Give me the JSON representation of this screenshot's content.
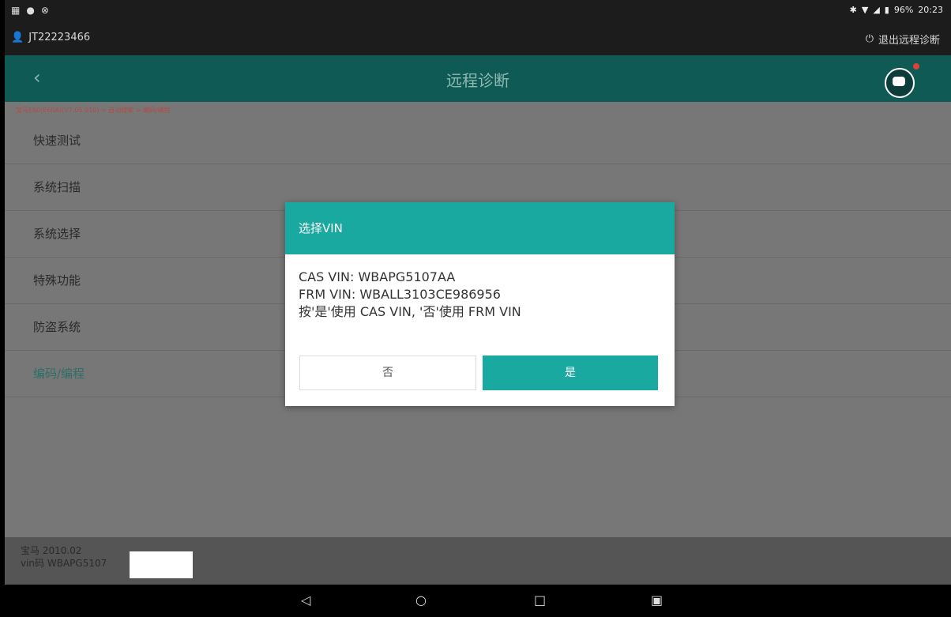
{
  "statusbar": {
    "user_id": "JT22223466",
    "battery": "96%",
    "time": "20:23",
    "exit_label": "退出远程诊断"
  },
  "header": {
    "title": "远程诊断"
  },
  "breadcrumb": "宝马E60(E60A)(V7.05.010) > 自动搜索 > 编码/编程",
  "menu": {
    "items": [
      {
        "label": "快速测试"
      },
      {
        "label": "系统扫描"
      },
      {
        "label": "系统选择"
      },
      {
        "label": "特殊功能"
      },
      {
        "label": "防盗系统"
      },
      {
        "label": "编码/编程"
      }
    ]
  },
  "footer": {
    "model": "宝马 2010.02",
    "vin_prefix": "vin码 WBAPG5107"
  },
  "dialog": {
    "title": "选择VIN",
    "line1": "CAS VIN: WBAPG5107AA",
    "line2": "FRM VIN: WBALL3103CE986956",
    "line3": "按'是'使用 CAS VIN, '否'使用 FRM VIN",
    "no_label": "否",
    "yes_label": "是"
  },
  "colors": {
    "accent": "#1aa9a0",
    "header": "#0f5a54"
  }
}
